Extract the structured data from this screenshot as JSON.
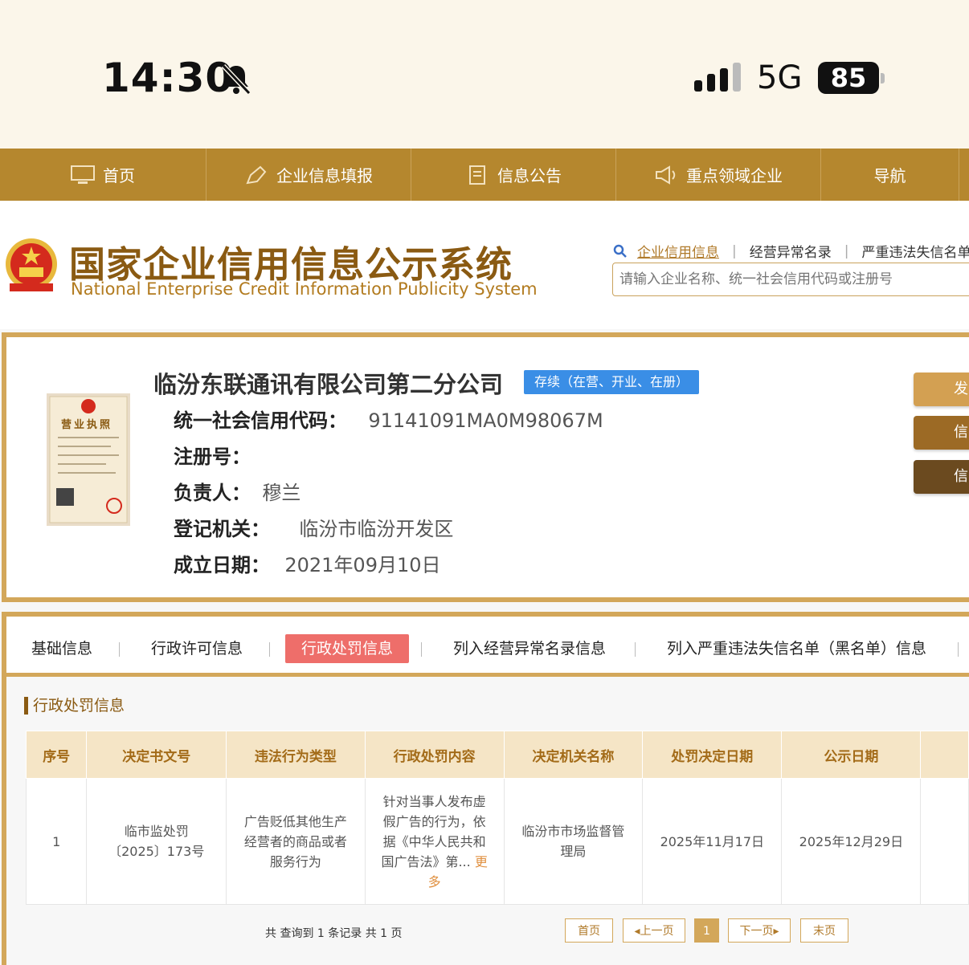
{
  "status_bar": {
    "time": "14:30",
    "network": "5G",
    "battery": "85"
  },
  "nav": [
    {
      "label": "首页",
      "icon": "monitor-icon"
    },
    {
      "label": "企业信息填报",
      "icon": "pen-icon"
    },
    {
      "label": "信息公告",
      "icon": "document-icon"
    },
    {
      "label": "重点领域企业",
      "icon": "megaphone-icon"
    },
    {
      "label": "导航",
      "icon": ""
    }
  ],
  "header": {
    "title": "国家企业信用信息公示系统",
    "subtitle": "National Enterprise Credit Information Publicity System",
    "search_tabs": [
      "企业信用信息",
      "经营异常名录",
      "严重违法失信名单"
    ],
    "search_placeholder": "请输入企业名称、统一社会信用代码或注册号"
  },
  "company": {
    "name": "临汾东联通讯有限公司第二分公司",
    "status": "存续（在营、开业、在册）",
    "license_label": "营业执照",
    "credit_code_label": "统一社会信用代码：",
    "credit_code": "91141091MA0M98067M",
    "reg_no_label": "注册号：",
    "reg_no": "",
    "leader_label": "负责人：",
    "leader": "穆兰",
    "authority_label": "登记机关：",
    "authority": "临汾市临汾开发区",
    "date_label": "成立日期：",
    "date": "2021年09月10日",
    "side_buttons": [
      {
        "label": "发",
        "color": "#d3a052"
      },
      {
        "label": "信",
        "color": "#9c6a25"
      },
      {
        "label": "信",
        "color": "#6b4a1f"
      }
    ]
  },
  "tabs": [
    "基础信息",
    "行政许可信息",
    "行政处罚信息",
    "列入经营异常名录信息",
    "列入严重违法失信名单（黑名单）信息"
  ],
  "active_tab": "行政处罚信息",
  "section_title": "行政处罚信息",
  "table": {
    "headers": [
      "序号",
      "决定书文号",
      "违法行为类型",
      "行政处罚内容",
      "决定机关名称",
      "处罚决定日期",
      "公示日期"
    ],
    "rows": [
      {
        "no": "1",
        "doc_no": "临市监处罚〔2025〕173号",
        "violation": "广告贬低其他生产经营者的商品或者服务行为",
        "content": "针对当事人发布虚假广告的行为，依据《中华人民共和国广告法》第...",
        "more": "更多",
        "authority": "临汾市市场监督管理局",
        "decision_date": "2025年11月17日",
        "publish_date": "2025年12月29日"
      }
    ]
  },
  "pager": {
    "summary": "共 查询到 1 条记录 共 1 页",
    "first": "首页",
    "prev": "上一页",
    "current": "1",
    "next": "下一页",
    "last": "末页"
  }
}
